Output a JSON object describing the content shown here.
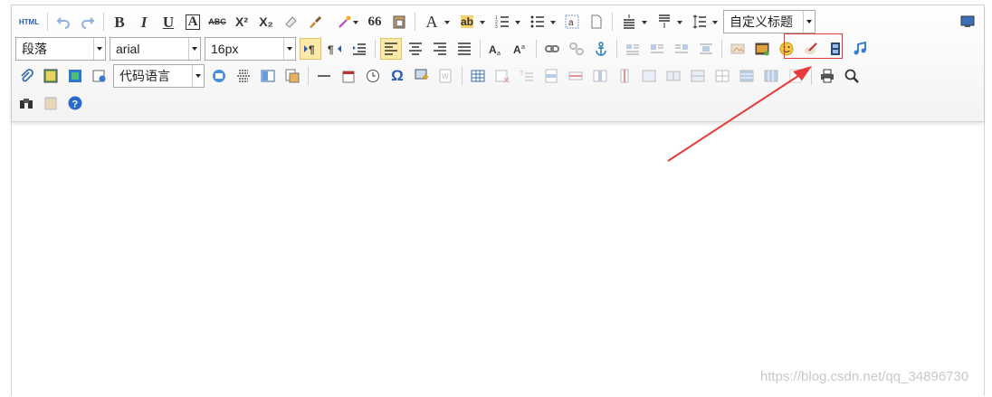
{
  "toolbar": {
    "html_label": "HTML",
    "bold": "B",
    "italic": "I",
    "underline": "U",
    "fontborder": "A",
    "strike": "ABC",
    "superscript": "X²",
    "subscript": "X₂",
    "blockquote": "66",
    "forecolor": "A",
    "backcolor": "ab",
    "custom_style": "自定义标题",
    "paragraph": "段落",
    "font_family": "arial",
    "font_size": "16px",
    "code_language": "代码语言",
    "omega": "Ω"
  },
  "watermark": "https://blog.csdn.net/qq_34896730",
  "colors": {
    "highlight_border": "#e23a3a",
    "arrow": "#e83a3a",
    "active_bg": "#fde9a8"
  }
}
